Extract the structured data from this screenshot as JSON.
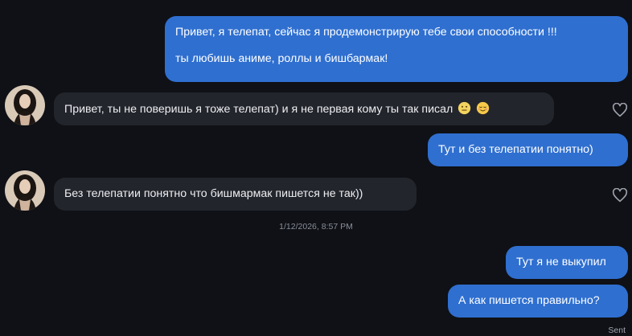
{
  "messages": [
    {
      "direction": "outgoing",
      "lines": [
        "Привет, я телепат, сейчас я продемонстрирую тебе свои способности !!!",
        "ты любишь аниме, роллы и бишбармак!"
      ]
    },
    {
      "direction": "incoming",
      "text": "Привет, ты не поверишь я тоже телепат) и я не первая кому ты так писал",
      "emojis": [
        "neutral-face-emoji",
        "relieved-face-emoji"
      ]
    },
    {
      "direction": "outgoing",
      "text": "Тут и без телепатии понятно)"
    },
    {
      "direction": "incoming",
      "text": "Без телепатии понятно что бишмармак пишется не так))"
    },
    {
      "direction": "outgoing",
      "text": "Тут я не выкупил"
    },
    {
      "direction": "outgoing",
      "text": "А как пишется правильно?"
    }
  ],
  "timestamp": "1/12/2026, 8:57 PM",
  "status": "Sent",
  "colors": {
    "background": "#0f1116",
    "outgoing_bubble": "#2f6fd0",
    "incoming_bubble": "#23252c",
    "meta_text": "#8a8e99"
  }
}
